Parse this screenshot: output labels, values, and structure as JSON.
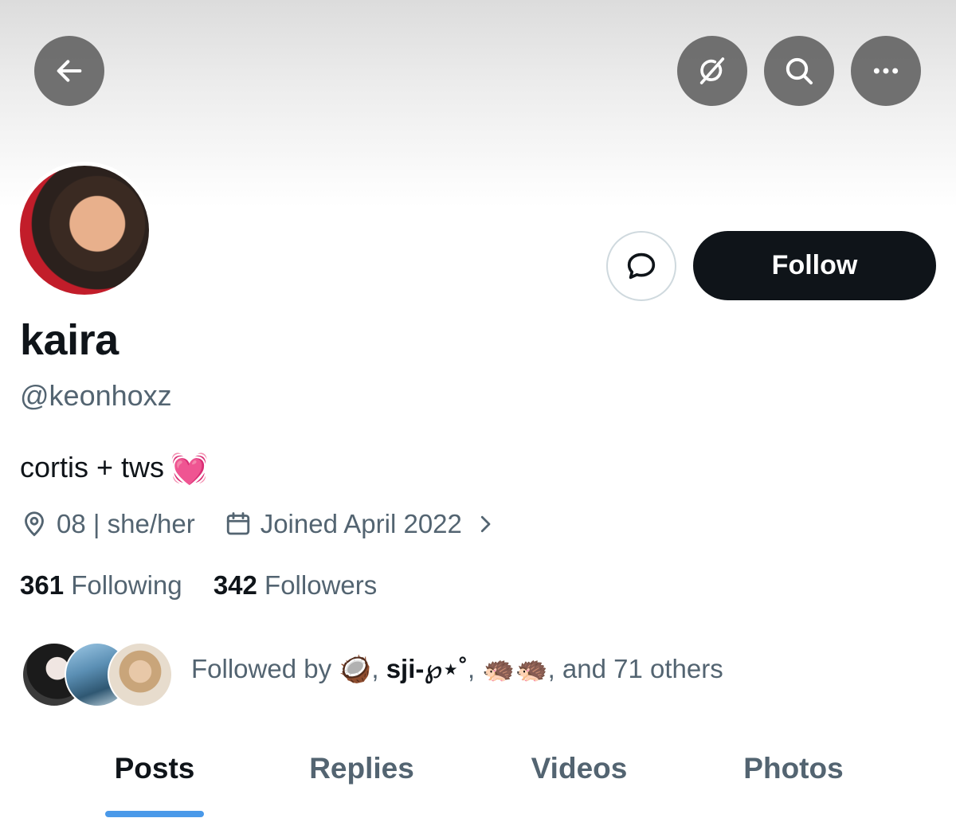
{
  "header": {
    "back_icon": "arrow-left-icon",
    "grok_icon": "grok-icon",
    "search_icon": "search-icon",
    "more_icon": "more-horizontal-icon"
  },
  "profile": {
    "display_name": "kaira",
    "handle": "@keonhoxz",
    "bio_text": "cortis + tws",
    "bio_emoji": "💓",
    "location": "08 | she/her",
    "joined": "Joined April 2022"
  },
  "actions": {
    "follow_label": "Follow",
    "message_icon": "message-bubble-icon"
  },
  "stats": {
    "following_count": "361",
    "following_label": "Following",
    "followers_count": "342",
    "followers_label": "Followers"
  },
  "followed_by": {
    "prefix": "Followed by",
    "user1": "🥥",
    "sep1": ",",
    "user2": "sji-℘⋆˚",
    "sep2": ",",
    "user3": "🦔🦔",
    "suffix": ", and 71 others"
  },
  "tabs": [
    {
      "label": "Posts",
      "active": true
    },
    {
      "label": "Replies",
      "active": false
    },
    {
      "label": "Videos",
      "active": false
    },
    {
      "label": "Photos",
      "active": false
    }
  ],
  "colors": {
    "text_primary": "#0f1419",
    "text_secondary": "#536471",
    "accent": "#4a99e9",
    "follow_bg": "#0f1419"
  }
}
